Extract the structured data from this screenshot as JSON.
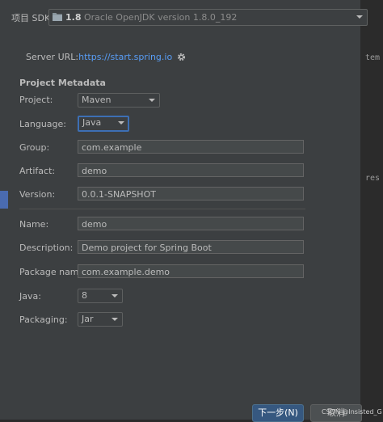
{
  "sdk": {
    "label": "项目 SDK:",
    "version": "1.8",
    "description": "Oracle OpenJDK version 1.8.0_192"
  },
  "server": {
    "label": "Server URL:",
    "url": "https://start.spring.io"
  },
  "metadata": {
    "heading": "Project Metadata",
    "project_label": "Project:",
    "project_value": "Maven",
    "language_label": "Language:",
    "language_value": "Java",
    "group_label": "Group:",
    "group_value": "com.example",
    "artifact_label": "Artifact:",
    "artifact_value": "demo",
    "version_label": "Version:",
    "version_value": "0.0.1-SNAPSHOT",
    "name_label": "Name:",
    "name_value": "demo",
    "description_label": "Description:",
    "description_value": "Demo project for Spring Boot",
    "package_label": "Package name:",
    "package_value": "com.example.demo",
    "java_label": "Java:",
    "java_value": "8",
    "packaging_label": "Packaging:",
    "packaging_value": "Jar"
  },
  "buttons": {
    "next": "下一步(N)",
    "cancel": "取消"
  },
  "background_text": {
    "line1": "tem",
    "line2": "res"
  },
  "watermark": "CSDN @Insisted_G",
  "colors": {
    "panel": "#3c3f41",
    "accent": "#365880",
    "focus": "#3d6fb4",
    "link": "#589df6"
  }
}
